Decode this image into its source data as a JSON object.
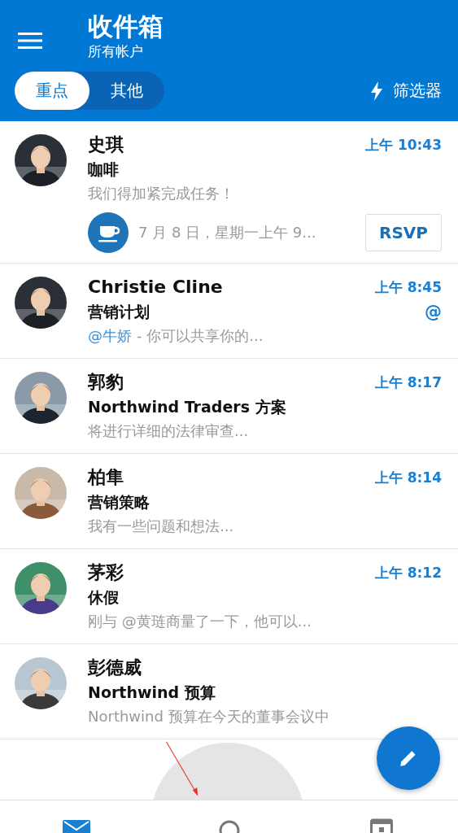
{
  "header": {
    "title": "收件箱",
    "subtitle": "所有帐户",
    "tabs": [
      {
        "label": "重点",
        "selected": true
      },
      {
        "label": "其他",
        "selected": false
      }
    ],
    "filter": "筛选器"
  },
  "messages": [
    {
      "sender": "史琪",
      "subject": "咖啡",
      "preview": "我们得加紧完成任务！",
      "time": "上午 10:43",
      "event": {
        "text": "7 月 8 日，星期一上午 9...",
        "button": "RSVP"
      }
    },
    {
      "sender": "Christie Cline",
      "subject": "营销计划",
      "preview_mention": "@牛娇",
      "preview": "- 你可以共享你的...",
      "time": "上午 8:45",
      "mention_mark": "@"
    },
    {
      "sender": "郭豹",
      "subject": "Northwind Traders 方案",
      "preview": "将进行详细的法律审查...",
      "time": "上午 8:17"
    },
    {
      "sender": "柏隼",
      "subject": "营销策略",
      "preview": "我有一些问题和想法...",
      "time": "上午 8:14"
    },
    {
      "sender": "茅彩",
      "subject": "休假",
      "preview": "刚与 @黄琏商量了一下，他可以...",
      "time": "上午 8:12"
    },
    {
      "sender": "彭德威",
      "subject": "Northwind 预算",
      "preview": "Northwind 预算在今天的董事会议中"
    }
  ],
  "nav": [
    {
      "kind": "mail",
      "selected": true
    },
    {
      "kind": "search",
      "selected": false
    },
    {
      "kind": "calendar",
      "selected": false
    }
  ]
}
